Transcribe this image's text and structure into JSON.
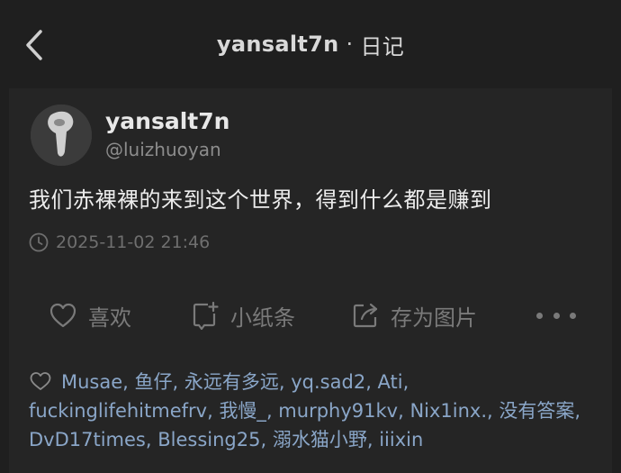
{
  "header": {
    "username": "yansalt7n",
    "separator": "·",
    "section": "日记"
  },
  "post": {
    "display_name": "yansalt7n",
    "handle": "@luizhuoyan",
    "content": "我们赤裸裸的来到这个世界，得到什么都是赚到",
    "timestamp": "2025-11-02 21:46"
  },
  "actions": {
    "like": "喜欢",
    "note": "小纸条",
    "save_image": "存为图片"
  },
  "likers": [
    "Musae",
    "鱼仔",
    "永远有多远",
    "yq.sad2",
    "Ati",
    "fuckinglifehitmefrv",
    "我慢_",
    "murphy91kv",
    "Nix1inx.",
    "没有答案",
    "DvD17times",
    "Blessing25",
    "溺水猫小野",
    "iiixin"
  ],
  "likers_separator": ", ",
  "icons": {
    "back": "chevron-left-icon",
    "clock": "clock-icon",
    "heart": "heart-icon",
    "note": "note-plus-icon",
    "share": "share-icon",
    "more": "more-dots-icon"
  },
  "colors": {
    "background": "#1f1f1f",
    "card": "#252525",
    "link": "#8aa6c8",
    "muted": "#7a7a7a"
  }
}
